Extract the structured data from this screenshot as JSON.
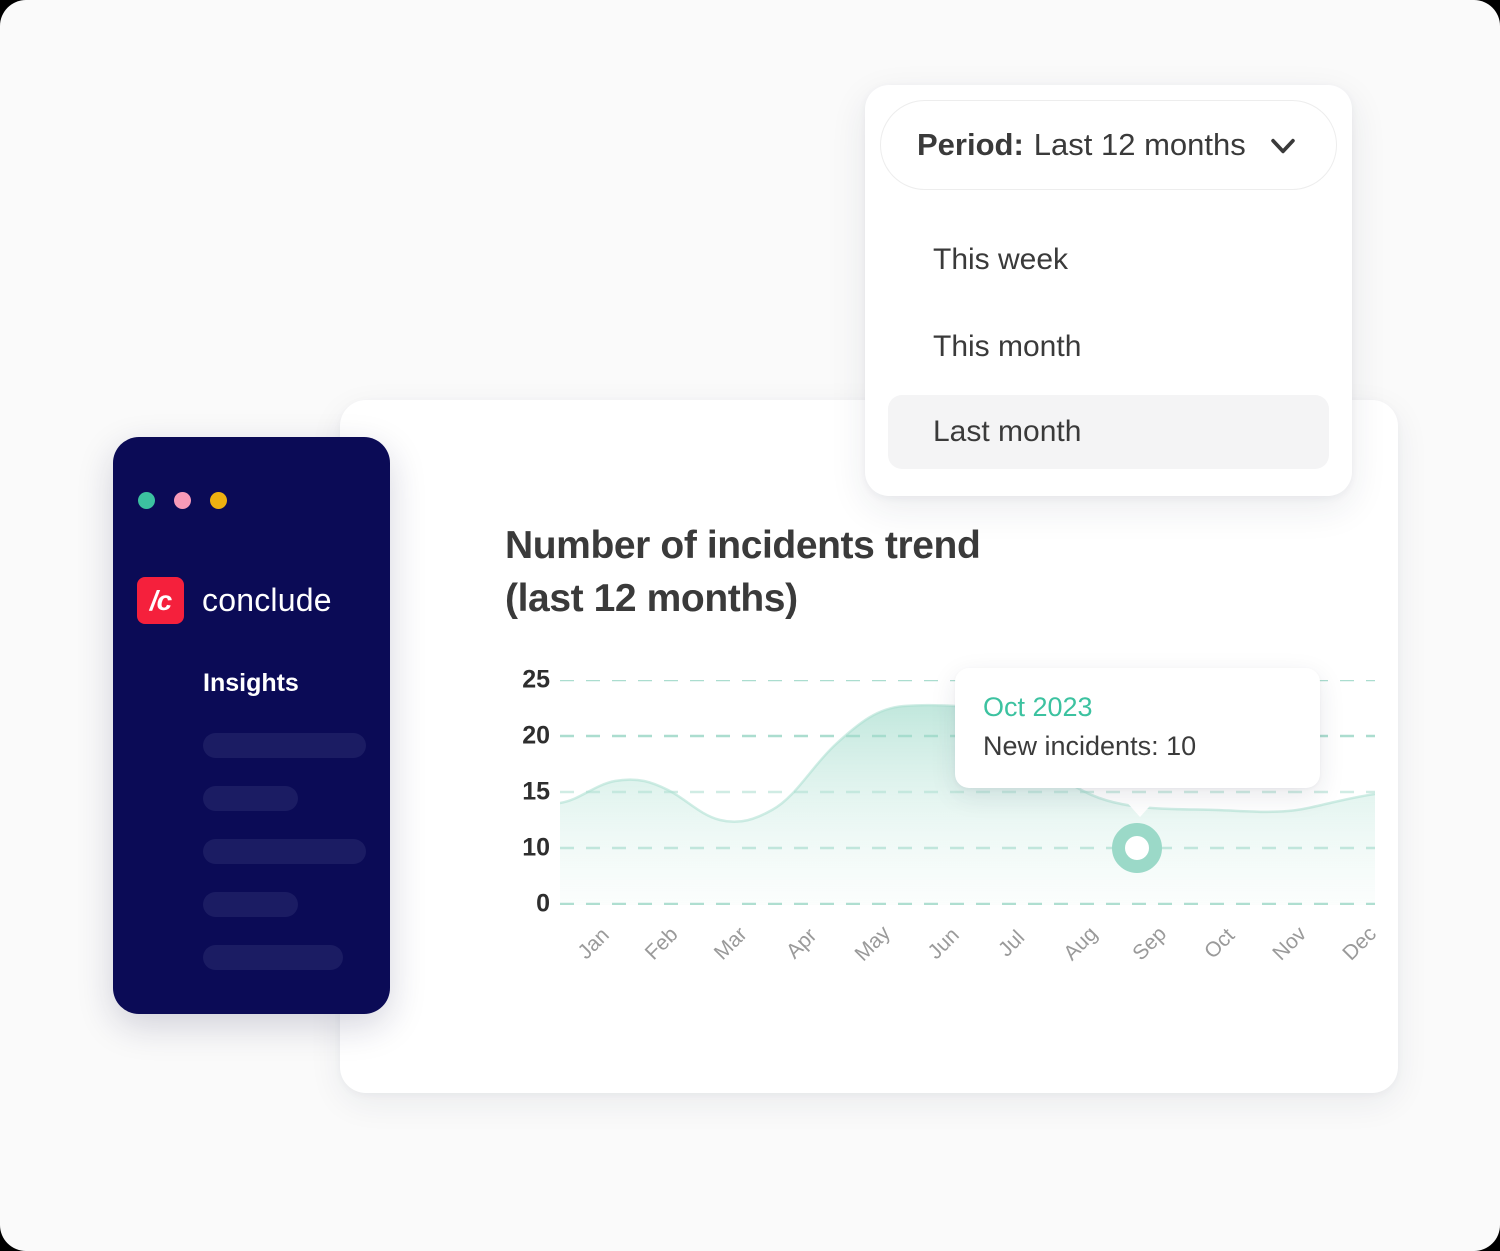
{
  "theme": {
    "page_background": "#fafafa",
    "sidebar_background": "#0b0b56",
    "brand_red": "#f5203c",
    "accent_green": "#3cc2a0",
    "chart_fill": "#9bd9c8",
    "text_dark": "#3a3a3a",
    "muted_text": "#9a9a9a"
  },
  "period_dropdown": {
    "trigger": {
      "label": "Period:",
      "value": "Last 12 months",
      "chevron_icon": "chevron-down-icon"
    },
    "options": [
      {
        "label": "This week",
        "selected": false
      },
      {
        "label": "This month",
        "selected": false
      },
      {
        "label": "Last month",
        "selected": true
      }
    ]
  },
  "app_window": {
    "window_dots": [
      {
        "name": "traffic-light-green",
        "color": "#3cc2a0"
      },
      {
        "name": "traffic-light-pink",
        "color": "#f79ab8"
      },
      {
        "name": "traffic-light-yellow",
        "color": "#eeb110"
      }
    ],
    "brand": {
      "mark": "/c",
      "name": "conclude"
    },
    "section_heading": "Insights",
    "nav_skeleton_widths": [
      "163px",
      "95px",
      "163px",
      "95px",
      "140px"
    ]
  },
  "chart_panel": {
    "title": "Number of incidents trend\n(last 12 months)",
    "tooltip": {
      "period": "Oct 2023",
      "value_text": "New incidents: 10"
    }
  },
  "chart_data": {
    "type": "area",
    "title": "Number of incidents trend (last 12 months)",
    "xlabel": "",
    "ylabel": "",
    "categories": [
      "Jan",
      "Feb",
      "Mar",
      "Apr",
      "May",
      "Jun",
      "Jul",
      "Aug",
      "Sep",
      "Oct",
      "Nov",
      "Dec"
    ],
    "values": [
      16,
      17.5,
      14,
      15,
      24,
      24,
      17,
      14,
      14,
      13.5,
      14,
      15
    ],
    "ytick_labels": [
      "25",
      "20",
      "15",
      "10",
      "0"
    ],
    "ytick_positions": [
      25,
      20,
      15,
      10,
      5
    ],
    "ylim": [
      0,
      27.5
    ],
    "grid": true,
    "grid_style": "dashed",
    "legend": "none",
    "highlight_point": {
      "category": "Oct",
      "label": "Oct 2023",
      "value": 10,
      "value_text": "New incidents: 10"
    },
    "series": [
      {
        "name": "New incidents",
        "values": [
          16,
          17.5,
          14,
          15,
          24,
          24,
          17,
          14,
          14,
          13.5,
          14,
          15
        ]
      }
    ]
  }
}
